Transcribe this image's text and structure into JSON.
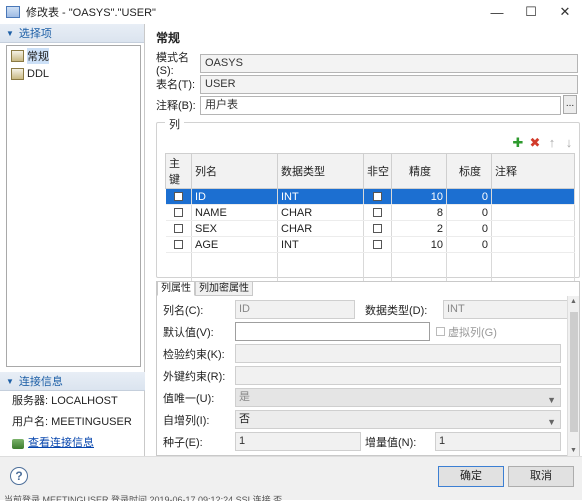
{
  "window": {
    "title": "修改表 - \"OASYS\".\"USER\"",
    "controls": [
      "—",
      "☐",
      "✕"
    ]
  },
  "left": {
    "options_header": "选择项",
    "tree": [
      {
        "label": "常规",
        "selected": true
      },
      {
        "label": "DDL",
        "selected": false
      }
    ],
    "conn_header": "连接信息",
    "server_label": "服务器: LOCALHOST",
    "user_label": "用户名: MEETINGUSER",
    "view_link": "查看连接信息"
  },
  "general": {
    "title": "常规",
    "schema_label": "模式名(S):",
    "schema_value": "OASYS",
    "table_label": "表名(T):",
    "table_value": "USER",
    "comment_label": "注释(B):",
    "comment_value": "用户表",
    "ellipsis": "..."
  },
  "columns": {
    "group_label": "列",
    "headers": [
      "主键",
      "列名",
      "数据类型",
      "非空",
      "精度",
      "标度",
      "注释"
    ],
    "rows": [
      {
        "pk": false,
        "name": "ID",
        "type": "INT",
        "notnull": false,
        "precision": "10",
        "scale": "0",
        "comment": ""
      },
      {
        "pk": false,
        "name": "NAME",
        "type": "CHAR",
        "notnull": false,
        "precision": "8",
        "scale": "0",
        "comment": ""
      },
      {
        "pk": false,
        "name": "SEX",
        "type": "CHAR",
        "notnull": false,
        "precision": "2",
        "scale": "0",
        "comment": ""
      },
      {
        "pk": false,
        "name": "AGE",
        "type": "INT",
        "notnull": false,
        "precision": "10",
        "scale": "0",
        "comment": ""
      }
    ],
    "selected_row": 0
  },
  "props": {
    "tabs": [
      "列属性",
      "列加密属性"
    ],
    "colname_label": "列名(C):",
    "colname_value": "ID",
    "datatype_label": "数据类型(D):",
    "datatype_value": "INT",
    "default_label": "默认值(V):",
    "default_value": "",
    "virtual_label": "虚拟列(G)",
    "check_label": "检验约束(K):",
    "fk_label": "外键约束(R):",
    "unique_label": "值唯一(U):",
    "unique_value": "是",
    "identity_label": "自增列(I):",
    "identity_value": "否",
    "seed_label": "种子(E):",
    "seed_value": "1",
    "increment_label": "增量值(N):",
    "increment_value": "1"
  },
  "footer": {
    "help": "?",
    "ok": "确定",
    "cancel": "取消",
    "status": "当前登录 MEETINGUSER     登录时间 2019-06-17 09:12:24     SSL连接 否"
  }
}
